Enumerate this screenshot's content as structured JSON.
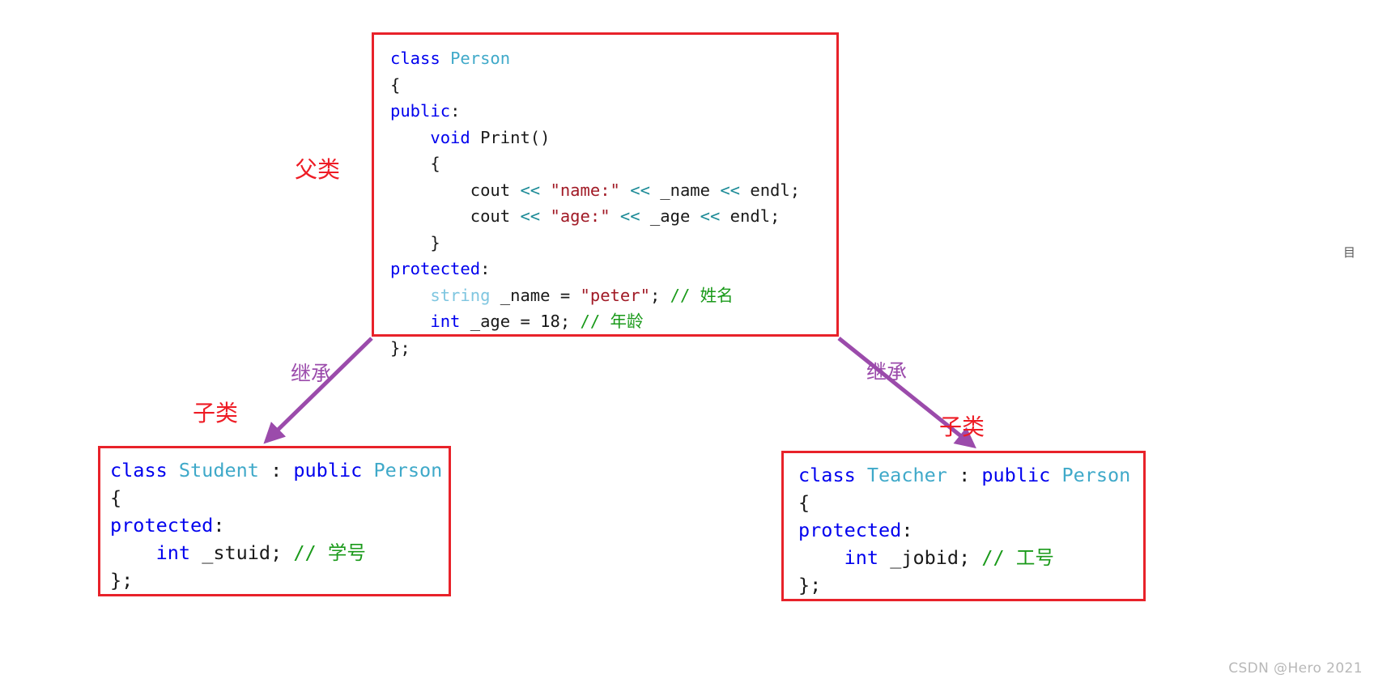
{
  "diagram": {
    "title": "C++ inheritance diagram: Person base class with Student and Teacher derived classes",
    "colors": {
      "box_border": "#e8222a",
      "arrow": "#9b4bab",
      "label_red": "#ee1c25",
      "label_purple": "#9b4bab",
      "keyword": "#0000ee",
      "class_name": "#3fa9c9",
      "string": "#a11a26",
      "stream_operator": "#1b8a96",
      "comment": "#1a9a1a",
      "watermark": "#b8b8b8"
    }
  },
  "boxes": {
    "person": {
      "name": "Person",
      "lines": [
        [
          {
            "t": "class ",
            "c": "kw"
          },
          {
            "t": "Person",
            "c": "type"
          }
        ],
        [
          {
            "t": "{",
            "c": "plain"
          }
        ],
        [
          {
            "t": "public",
            "c": "kw"
          },
          {
            "t": ":",
            "c": "plain"
          }
        ],
        [
          {
            "t": "    ",
            "c": "plain"
          },
          {
            "t": "void ",
            "c": "kw"
          },
          {
            "t": "Print()",
            "c": "plain"
          }
        ],
        [
          {
            "t": "    {",
            "c": "plain"
          }
        ],
        [
          {
            "t": "        cout ",
            "c": "plain"
          },
          {
            "t": "<<",
            "c": "op"
          },
          {
            "t": " ",
            "c": "plain"
          },
          {
            "t": "\"name:\"",
            "c": "str"
          },
          {
            "t": " ",
            "c": "plain"
          },
          {
            "t": "<<",
            "c": "op"
          },
          {
            "t": " _name ",
            "c": "plain"
          },
          {
            "t": "<<",
            "c": "op"
          },
          {
            "t": " endl;",
            "c": "plain"
          }
        ],
        [
          {
            "t": "        cout ",
            "c": "plain"
          },
          {
            "t": "<<",
            "c": "op"
          },
          {
            "t": " ",
            "c": "plain"
          },
          {
            "t": "\"age:\"",
            "c": "str"
          },
          {
            "t": " ",
            "c": "plain"
          },
          {
            "t": "<<",
            "c": "op"
          },
          {
            "t": " _age ",
            "c": "plain"
          },
          {
            "t": "<<",
            "c": "op"
          },
          {
            "t": " endl;",
            "c": "plain"
          }
        ],
        [
          {
            "t": "    }",
            "c": "plain"
          }
        ],
        [
          {
            "t": "protected",
            "c": "kw"
          },
          {
            "t": ":",
            "c": "plain"
          }
        ],
        [
          {
            "t": "    ",
            "c": "plain"
          },
          {
            "t": "string",
            "c": "stype"
          },
          {
            "t": " _name = ",
            "c": "plain"
          },
          {
            "t": "\"peter\"",
            "c": "str"
          },
          {
            "t": "; ",
            "c": "plain"
          },
          {
            "t": "// 姓名",
            "c": "cmt"
          }
        ],
        [
          {
            "t": "    ",
            "c": "plain"
          },
          {
            "t": "int",
            "c": "kw"
          },
          {
            "t": " _age = 18; ",
            "c": "plain"
          },
          {
            "t": "// 年龄",
            "c": "cmt"
          }
        ],
        [
          {
            "t": "};",
            "c": "plain"
          }
        ]
      ]
    },
    "student": {
      "name": "Student",
      "lines": [
        [
          {
            "t": "class ",
            "c": "kw"
          },
          {
            "t": "Student",
            "c": "type"
          },
          {
            "t": " : ",
            "c": "plain"
          },
          {
            "t": "public ",
            "c": "kw"
          },
          {
            "t": "Person",
            "c": "type"
          }
        ],
        [
          {
            "t": "{",
            "c": "plain"
          }
        ],
        [
          {
            "t": "protected",
            "c": "kw"
          },
          {
            "t": ":",
            "c": "plain"
          }
        ],
        [
          {
            "t": "    ",
            "c": "plain"
          },
          {
            "t": "int",
            "c": "kw"
          },
          {
            "t": " _stuid; ",
            "c": "plain"
          },
          {
            "t": "// 学号",
            "c": "cmt"
          }
        ],
        [
          {
            "t": "};",
            "c": "plain"
          }
        ]
      ]
    },
    "teacher": {
      "name": "Teacher",
      "lines": [
        [
          {
            "t": "class ",
            "c": "kw"
          },
          {
            "t": "Teacher",
            "c": "type"
          },
          {
            "t": " : ",
            "c": "plain"
          },
          {
            "t": "public ",
            "c": "kw"
          },
          {
            "t": "Person",
            "c": "type"
          }
        ],
        [
          {
            "t": "{",
            "c": "plain"
          }
        ],
        [
          {
            "t": "protected",
            "c": "kw"
          },
          {
            "t": ":",
            "c": "plain"
          }
        ],
        [
          {
            "t": "    ",
            "c": "plain"
          },
          {
            "t": "int",
            "c": "kw"
          },
          {
            "t": " _jobid; ",
            "c": "plain"
          },
          {
            "t": "// 工号",
            "c": "cmt"
          }
        ],
        [
          {
            "t": "};",
            "c": "plain"
          }
        ]
      ]
    }
  },
  "labels": {
    "parent_class": "父类",
    "child_class_left": "子类",
    "child_class_right": "子类",
    "inherit_left": "继承",
    "inherit_right": "继承"
  },
  "watermark": "CSDN @Hero 2021",
  "stray_glyph": "目"
}
